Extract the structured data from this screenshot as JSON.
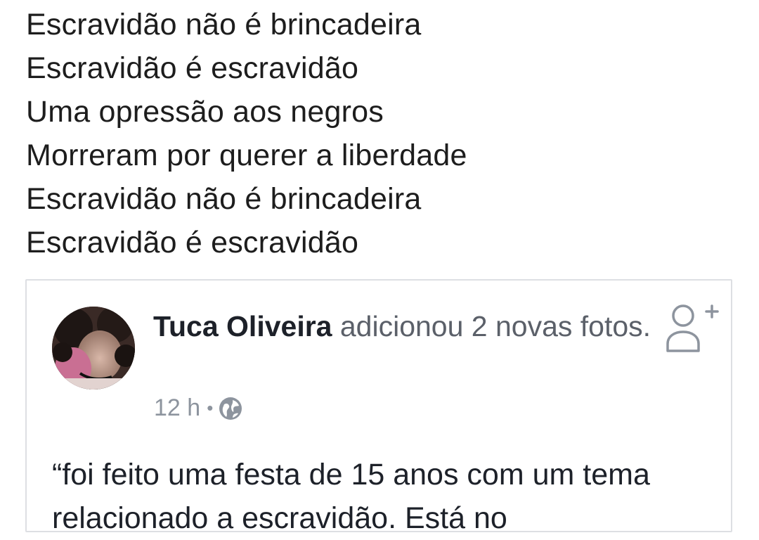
{
  "poem": {
    "lines": [
      "Escravidão não é brincadeira",
      "Escravidão é escravidão",
      "Uma opressão aos negros",
      "Morreram por querer a liberdade",
      "Escravidão não é brincadeira",
      "Escravidão é escravidão"
    ]
  },
  "shared_post": {
    "author": "Tuca Oliveira",
    "action": "adicionou 2 novas fotos.",
    "time": "12 h",
    "separator": "•",
    "privacy_icon": "globe-icon",
    "add_friend_icon": "add-friend-icon",
    "text": "“foi feito uma festa de 15 anos com um tema relacionado a escravidão. Está no"
  },
  "colors": {
    "text_dark": "#1d2129",
    "text_muted": "#5b6069",
    "meta_gray": "#8d949e",
    "card_border": "#dddfe3"
  }
}
